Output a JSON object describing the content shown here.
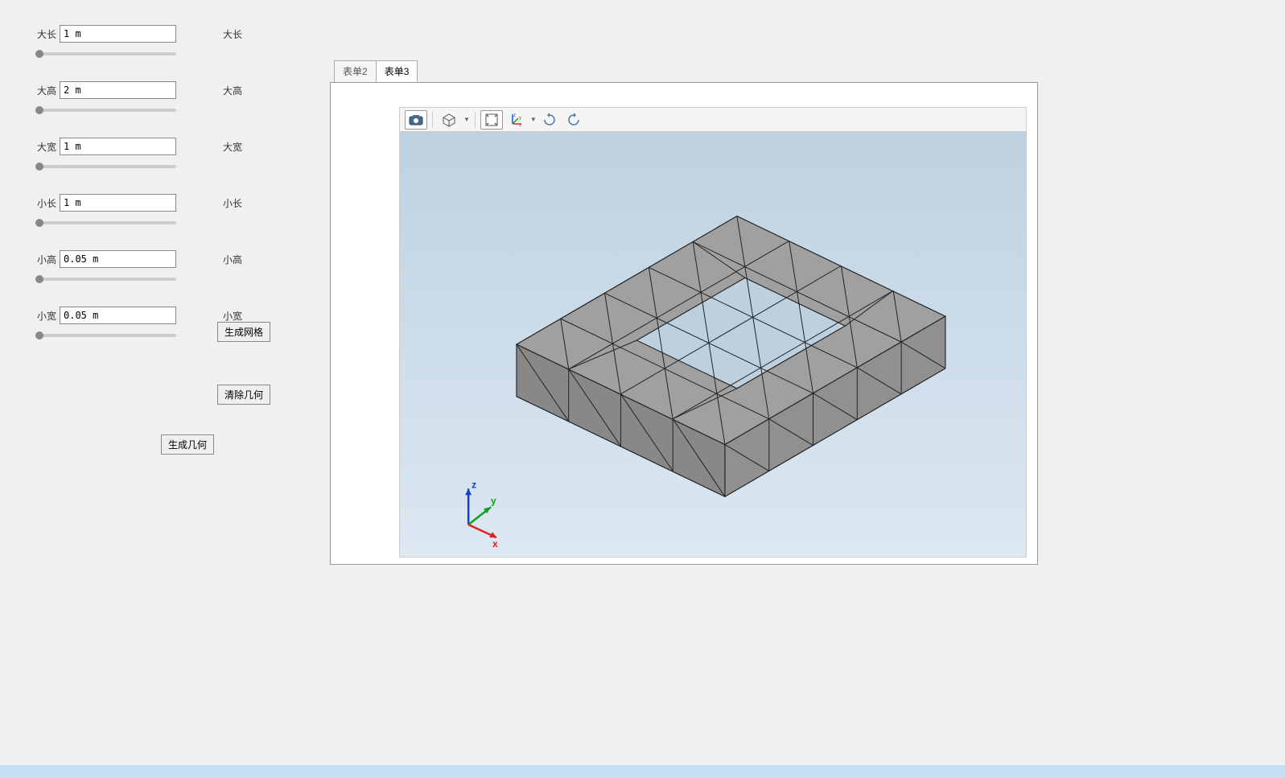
{
  "params": [
    {
      "key": "big_length",
      "label": "大长",
      "value": "1 m",
      "label_right": "大长"
    },
    {
      "key": "big_height",
      "label": "大高",
      "value": "2 m",
      "label_right": "大高"
    },
    {
      "key": "big_width",
      "label": "大宽",
      "value": "1 m",
      "label_right": "大宽"
    },
    {
      "key": "small_length",
      "label": "小长",
      "value": "1 m",
      "label_right": "小长"
    },
    {
      "key": "small_height",
      "label": "小高",
      "value": "0.05 m",
      "label_right": "小高"
    },
    {
      "key": "small_width",
      "label": "小宽",
      "value": "0.05 m",
      "label_right": "小宽"
    }
  ],
  "buttons": {
    "generate_mesh": "生成网格",
    "clear_geometry": "清除几何",
    "generate_geometry": "生成几何"
  },
  "tabs": {
    "tab2": "表单2",
    "tab3": "表单3",
    "active": "tab3"
  },
  "axis_labels": {
    "x": "x",
    "y": "y",
    "z": "z"
  }
}
